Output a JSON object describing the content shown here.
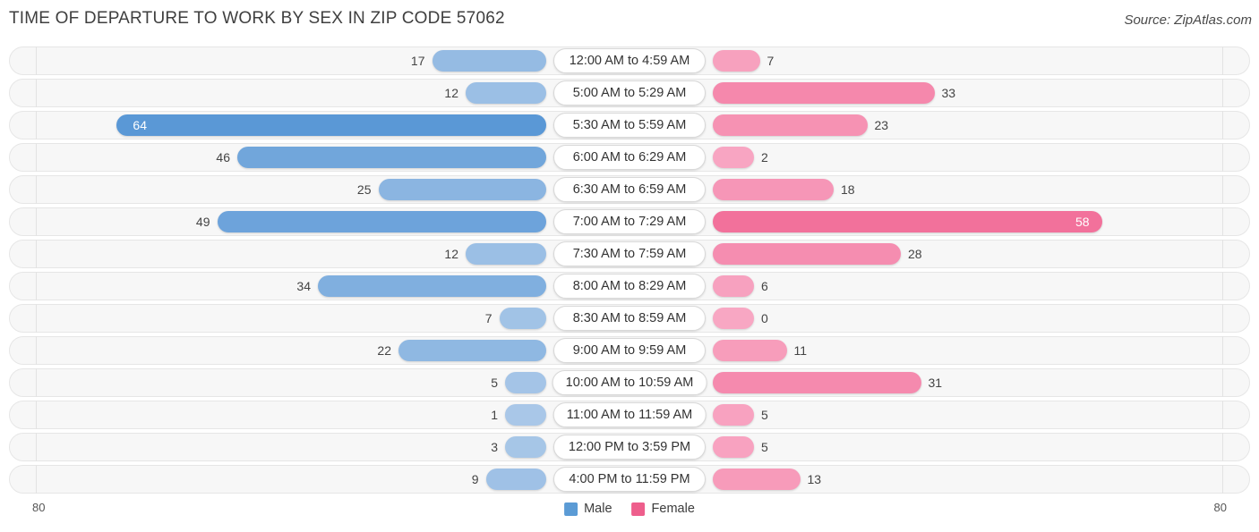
{
  "header": {
    "title": "TIME OF DEPARTURE TO WORK BY SEX IN ZIP CODE 57062",
    "source": "Source: ZipAtlas.com"
  },
  "legend": {
    "male_label": "Male",
    "female_label": "Female",
    "male_color": "#5B9BD5",
    "female_color": "#EE5E8C"
  },
  "axis": {
    "left_max": "80",
    "right_max": "80"
  },
  "chart_data": {
    "type": "bar",
    "title": "TIME OF DEPARTURE TO WORK BY SEX IN ZIP CODE 57062",
    "subtitle": "Source: ZipAtlas.com",
    "orientation": "horizontal-diverging",
    "xlabel": "",
    "ylabel": "",
    "xlim": [
      80,
      80
    ],
    "grid": false,
    "legend_position": "bottom-center",
    "categories": [
      "12:00 AM to 4:59 AM",
      "5:00 AM to 5:29 AM",
      "5:30 AM to 5:59 AM",
      "6:00 AM to 6:29 AM",
      "6:30 AM to 6:59 AM",
      "7:00 AM to 7:29 AM",
      "7:30 AM to 7:59 AM",
      "8:00 AM to 8:29 AM",
      "8:30 AM to 8:59 AM",
      "9:00 AM to 9:59 AM",
      "10:00 AM to 10:59 AM",
      "11:00 AM to 11:59 AM",
      "12:00 PM to 3:59 PM",
      "4:00 PM to 11:59 PM"
    ],
    "series": [
      {
        "name": "Male",
        "values": [
          17,
          12,
          64,
          46,
          25,
          49,
          12,
          34,
          7,
          22,
          5,
          1,
          3,
          9
        ]
      },
      {
        "name": "Female",
        "values": [
          7,
          33,
          23,
          2,
          18,
          58,
          28,
          6,
          0,
          11,
          31,
          5,
          5,
          13
        ]
      }
    ]
  }
}
